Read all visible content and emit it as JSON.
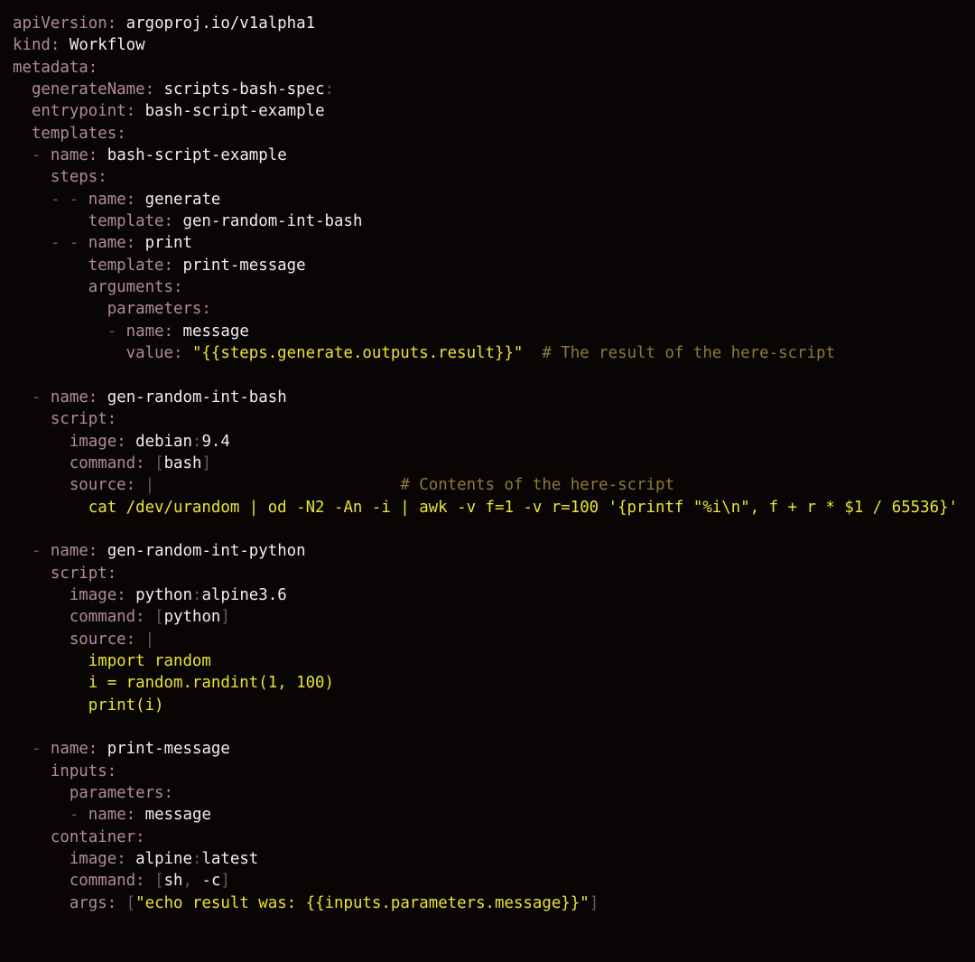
{
  "editor": {
    "language": "yaml",
    "background": "#0a0505",
    "colors": {
      "key": "#b08a9c",
      "value": "#f2ecec",
      "string": "#e8e337",
      "comment": "#8a7a3a",
      "punctuation": "#6d5560"
    }
  },
  "document": {
    "title": "scripts-bash-spec",
    "lines": [
      {
        "indent": 0,
        "tokens": [
          {
            "t": "k",
            "x": "apiVersion"
          },
          {
            "t": "colon",
            "x": ":"
          },
          {
            "t": "v",
            "x": " argoproj.io/v1alpha1"
          }
        ]
      },
      {
        "indent": 0,
        "tokens": [
          {
            "t": "k",
            "x": "kind"
          },
          {
            "t": "colon",
            "x": ":"
          },
          {
            "t": "v",
            "x": " Workflow"
          }
        ]
      },
      {
        "indent": 0,
        "tokens": [
          {
            "t": "k",
            "x": "metadata"
          },
          {
            "t": "colon",
            "x": ":"
          }
        ]
      },
      {
        "indent": 2,
        "tokens": [
          {
            "t": "k",
            "x": "generateName"
          },
          {
            "t": "colon",
            "x": ":"
          },
          {
            "t": "v",
            "x": " scripts-bash-spec"
          },
          {
            "t": "p",
            "x": ":"
          }
        ]
      },
      {
        "indent": 2,
        "tokens": [
          {
            "t": "k",
            "x": "entrypoint"
          },
          {
            "t": "colon",
            "x": ":"
          },
          {
            "t": "v",
            "x": " bash-script-example"
          }
        ]
      },
      {
        "indent": 2,
        "tokens": [
          {
            "t": "k",
            "x": "templates"
          },
          {
            "t": "colon",
            "x": ":"
          }
        ]
      },
      {
        "indent": 2,
        "tokens": [
          {
            "t": "p",
            "x": "- "
          },
          {
            "t": "k",
            "x": "name"
          },
          {
            "t": "colon",
            "x": ":"
          },
          {
            "t": "v",
            "x": " bash-script-example"
          }
        ]
      },
      {
        "indent": 4,
        "tokens": [
          {
            "t": "k",
            "x": "steps"
          },
          {
            "t": "colon",
            "x": ":"
          }
        ]
      },
      {
        "indent": 4,
        "tokens": [
          {
            "t": "p",
            "x": "- - "
          },
          {
            "t": "k",
            "x": "name"
          },
          {
            "t": "colon",
            "x": ":"
          },
          {
            "t": "v",
            "x": " generate"
          }
        ]
      },
      {
        "indent": 8,
        "tokens": [
          {
            "t": "k",
            "x": "template"
          },
          {
            "t": "colon",
            "x": ":"
          },
          {
            "t": "v",
            "x": " gen-random-int-bash"
          }
        ]
      },
      {
        "indent": 4,
        "tokens": [
          {
            "t": "p",
            "x": "- - "
          },
          {
            "t": "k",
            "x": "name"
          },
          {
            "t": "colon",
            "x": ":"
          },
          {
            "t": "v",
            "x": " print"
          }
        ]
      },
      {
        "indent": 8,
        "tokens": [
          {
            "t": "k",
            "x": "template"
          },
          {
            "t": "colon",
            "x": ":"
          },
          {
            "t": "v",
            "x": " print-message"
          }
        ]
      },
      {
        "indent": 8,
        "tokens": [
          {
            "t": "k",
            "x": "arguments"
          },
          {
            "t": "colon",
            "x": ":"
          }
        ]
      },
      {
        "indent": 10,
        "tokens": [
          {
            "t": "k",
            "x": "parameters"
          },
          {
            "t": "colon",
            "x": ":"
          }
        ]
      },
      {
        "indent": 10,
        "tokens": [
          {
            "t": "p",
            "x": "- "
          },
          {
            "t": "k",
            "x": "name"
          },
          {
            "t": "colon",
            "x": ":"
          },
          {
            "t": "v",
            "x": " message"
          }
        ]
      },
      {
        "indent": 12,
        "tokens": [
          {
            "t": "k",
            "x": "value"
          },
          {
            "t": "colon",
            "x": ":"
          },
          {
            "t": "s",
            "x": " \"{{steps.generate.outputs.result}}\""
          },
          {
            "t": "c",
            "x": "  # The result of the here-script"
          }
        ]
      },
      {
        "indent": 0,
        "tokens": []
      },
      {
        "indent": 2,
        "tokens": [
          {
            "t": "p",
            "x": "- "
          },
          {
            "t": "k",
            "x": "name"
          },
          {
            "t": "colon",
            "x": ":"
          },
          {
            "t": "v",
            "x": " gen-random-int-bash"
          }
        ]
      },
      {
        "indent": 4,
        "tokens": [
          {
            "t": "k",
            "x": "script"
          },
          {
            "t": "colon",
            "x": ":"
          }
        ]
      },
      {
        "indent": 6,
        "tokens": [
          {
            "t": "k",
            "x": "image"
          },
          {
            "t": "colon",
            "x": ":"
          },
          {
            "t": "v",
            "x": " debian"
          },
          {
            "t": "p",
            "x": ":"
          },
          {
            "t": "v",
            "x": "9.4"
          }
        ]
      },
      {
        "indent": 6,
        "tokens": [
          {
            "t": "k",
            "x": "command"
          },
          {
            "t": "colon",
            "x": ":"
          },
          {
            "t": "p",
            "x": " ["
          },
          {
            "t": "v",
            "x": "bash"
          },
          {
            "t": "p",
            "x": "]"
          }
        ]
      },
      {
        "indent": 6,
        "tokens": [
          {
            "t": "k",
            "x": "source"
          },
          {
            "t": "colon",
            "x": ":"
          },
          {
            "t": "p",
            "x": " |"
          },
          {
            "t": "c",
            "x": "                          # Contents of the here-script"
          }
        ]
      },
      {
        "indent": 8,
        "tokens": [
          {
            "t": "s",
            "x": "cat /dev/urandom | od -N2 -An -i | awk -v f=1 -v r=100 '{printf \"%i\\n\", f + r * $1 / 65536}'"
          }
        ]
      },
      {
        "indent": 0,
        "tokens": []
      },
      {
        "indent": 2,
        "tokens": [
          {
            "t": "p",
            "x": "- "
          },
          {
            "t": "k",
            "x": "name"
          },
          {
            "t": "colon",
            "x": ":"
          },
          {
            "t": "v",
            "x": " gen-random-int-python"
          }
        ]
      },
      {
        "indent": 4,
        "tokens": [
          {
            "t": "k",
            "x": "script"
          },
          {
            "t": "colon",
            "x": ":"
          }
        ]
      },
      {
        "indent": 6,
        "tokens": [
          {
            "t": "k",
            "x": "image"
          },
          {
            "t": "colon",
            "x": ":"
          },
          {
            "t": "v",
            "x": " python"
          },
          {
            "t": "p",
            "x": ":"
          },
          {
            "t": "v",
            "x": "alpine3.6"
          }
        ]
      },
      {
        "indent": 6,
        "tokens": [
          {
            "t": "k",
            "x": "command"
          },
          {
            "t": "colon",
            "x": ":"
          },
          {
            "t": "p",
            "x": " ["
          },
          {
            "t": "v",
            "x": "python"
          },
          {
            "t": "p",
            "x": "]"
          }
        ]
      },
      {
        "indent": 6,
        "tokens": [
          {
            "t": "k",
            "x": "source"
          },
          {
            "t": "colon",
            "x": ":"
          },
          {
            "t": "p",
            "x": " |"
          }
        ]
      },
      {
        "indent": 8,
        "tokens": [
          {
            "t": "s",
            "x": "import random"
          }
        ]
      },
      {
        "indent": 8,
        "tokens": [
          {
            "t": "s",
            "x": "i = random.randint(1, 100)"
          }
        ]
      },
      {
        "indent": 8,
        "tokens": [
          {
            "t": "s",
            "x": "print(i)"
          }
        ]
      },
      {
        "indent": 0,
        "tokens": []
      },
      {
        "indent": 2,
        "tokens": [
          {
            "t": "p",
            "x": "- "
          },
          {
            "t": "k",
            "x": "name"
          },
          {
            "t": "colon",
            "x": ":"
          },
          {
            "t": "v",
            "x": " print-message"
          }
        ]
      },
      {
        "indent": 4,
        "tokens": [
          {
            "t": "k",
            "x": "inputs"
          },
          {
            "t": "colon",
            "x": ":"
          }
        ]
      },
      {
        "indent": 6,
        "tokens": [
          {
            "t": "k",
            "x": "parameters"
          },
          {
            "t": "colon",
            "x": ":"
          }
        ]
      },
      {
        "indent": 6,
        "tokens": [
          {
            "t": "p",
            "x": "- "
          },
          {
            "t": "k",
            "x": "name"
          },
          {
            "t": "colon",
            "x": ":"
          },
          {
            "t": "v",
            "x": " message"
          }
        ]
      },
      {
        "indent": 4,
        "tokens": [
          {
            "t": "k",
            "x": "container"
          },
          {
            "t": "colon",
            "x": ":"
          }
        ]
      },
      {
        "indent": 6,
        "tokens": [
          {
            "t": "k",
            "x": "image"
          },
          {
            "t": "colon",
            "x": ":"
          },
          {
            "t": "v",
            "x": " alpine"
          },
          {
            "t": "p",
            "x": ":"
          },
          {
            "t": "v",
            "x": "latest"
          }
        ]
      },
      {
        "indent": 6,
        "tokens": [
          {
            "t": "k",
            "x": "command"
          },
          {
            "t": "colon",
            "x": ":"
          },
          {
            "t": "p",
            "x": " ["
          },
          {
            "t": "v",
            "x": "sh"
          },
          {
            "t": "p",
            "x": ", "
          },
          {
            "t": "v",
            "x": "-c"
          },
          {
            "t": "p",
            "x": "]"
          }
        ]
      },
      {
        "indent": 6,
        "tokens": [
          {
            "t": "k",
            "x": "args"
          },
          {
            "t": "colon",
            "x": ":"
          },
          {
            "t": "p",
            "x": " ["
          },
          {
            "t": "s",
            "x": "\"echo result was: {{inputs.parameters.message}}\""
          },
          {
            "t": "p",
            "x": "]"
          }
        ]
      }
    ]
  }
}
